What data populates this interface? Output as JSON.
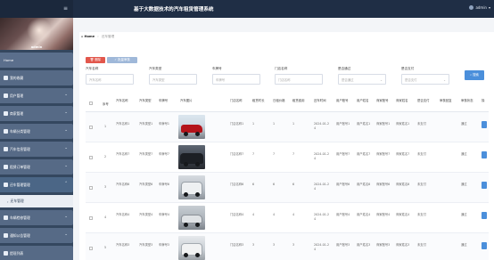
{
  "app": {
    "title": "基于大数据技术的汽车租赁管理系统",
    "user": "admin"
  },
  "sidebar": {
    "username": "admin",
    "items": [
      {
        "label": "Home"
      },
      {
        "label": "我的收藏"
      },
      {
        "label": "用户管理"
      },
      {
        "label": "商家管理"
      },
      {
        "label": "车辆分类管理"
      },
      {
        "label": "汽车信息管理"
      },
      {
        "label": "租赁订单管理"
      },
      {
        "label": "还车管理管理"
      },
      {
        "label": "车辆检修管理"
      },
      {
        "label": "通知公告管理"
      },
      {
        "label": "提现列表"
      }
    ],
    "active_sub": "还车管理"
  },
  "breadcrumb": {
    "home": "Home",
    "current": "还车管理"
  },
  "toolbar": {
    "delete_label": "删除",
    "bulk_label": "批量审核"
  },
  "filters": [
    {
      "label": "汽车名称",
      "placeholder": "汽车名称",
      "type": "input"
    },
    {
      "label": "汽车类型",
      "placeholder": "汽车类型",
      "type": "input"
    },
    {
      "label": "车牌号",
      "placeholder": "车牌号",
      "type": "input"
    },
    {
      "label": "门店名称",
      "placeholder": "门店名称",
      "type": "input"
    },
    {
      "label": "是否通过",
      "placeholder": "是否通过",
      "type": "select"
    },
    {
      "label": "是否支付",
      "placeholder": "是否支付",
      "type": "select"
    }
  ],
  "search_label": "搜索",
  "table": {
    "headers": [
      "序号",
      "汽车名称",
      "汽车类型",
      "车牌号",
      "汽车图片",
      "门店名称",
      "租赁时长",
      "日租价格",
      "租赁费用",
      "还车时间",
      "用户账号",
      "用户姓名",
      "商家账号",
      "商家姓名",
      "是否支付",
      "审核回复",
      "审核状态",
      "操"
    ],
    "rows": [
      {
        "no": "1",
        "car_name": "汽车名称1",
        "car_type": "汽车类型1",
        "plate": "车牌号1",
        "car_image": "red",
        "store": "门店名称1",
        "duration": "1",
        "daily": "1",
        "fee": "1",
        "return_time": "2024-01-2\n4",
        "user_acc": "用户账号1",
        "user_name": "用户姓名1",
        "biz_acc": "商家账号1",
        "biz_name": "商家姓名1",
        "paid": "未支付",
        "reply": "",
        "status": "通过"
      },
      {
        "no": "2",
        "car_name": "汽车名称7",
        "car_type": "汽车类型7",
        "plate": "车牌号7",
        "car_image": "dark",
        "store": "门店名称7",
        "duration": "7",
        "daily": "7",
        "fee": "7",
        "return_time": "2024-01-2\n4",
        "user_acc": "用户账号7",
        "user_name": "用户姓名7",
        "biz_acc": "商家账号7",
        "biz_name": "商家姓名7",
        "paid": "未支付",
        "reply": "",
        "status": "通过"
      },
      {
        "no": "3",
        "car_name": "汽车名称6",
        "car_type": "汽车类型6",
        "plate": "车牌号6",
        "car_image": "white",
        "store": "门店名称6",
        "duration": "6",
        "daily": "6",
        "fee": "6",
        "return_time": "2024-01-2\n4",
        "user_acc": "用户账号6",
        "user_name": "用户姓名6",
        "biz_acc": "商家账号6",
        "biz_name": "商家姓名6",
        "paid": "未支付",
        "reply": "",
        "status": "通过"
      },
      {
        "no": "4",
        "car_name": "汽车名称4",
        "car_type": "汽车类型4",
        "plate": "车牌号4",
        "car_image": "gray",
        "store": "门店名称4",
        "duration": "4",
        "daily": "4",
        "fee": "4",
        "return_time": "2024-01-2\n4",
        "user_acc": "用户账号4",
        "user_name": "用户姓名4",
        "biz_acc": "商家账号4",
        "biz_name": "商家姓名4",
        "paid": "未支付",
        "reply": "",
        "status": "通过"
      },
      {
        "no": "5",
        "car_name": "汽车名称3",
        "car_type": "汽车类型3",
        "plate": "车牌号3",
        "car_image": "silver",
        "store": "门店名称3",
        "duration": "3",
        "daily": "3",
        "fee": "3",
        "return_time": "2024-01-2\n4",
        "user_acc": "用户账号3",
        "user_name": "用户姓名3",
        "biz_acc": "商家账号3",
        "biz_name": "商家姓名3",
        "paid": "未支付",
        "reply": "",
        "status": "通过"
      }
    ]
  },
  "colors": {
    "header_bg": "#1f2e45",
    "sidebar_bg": "#34475f",
    "danger": "#e2574c",
    "primary": "#4b8fdb"
  }
}
